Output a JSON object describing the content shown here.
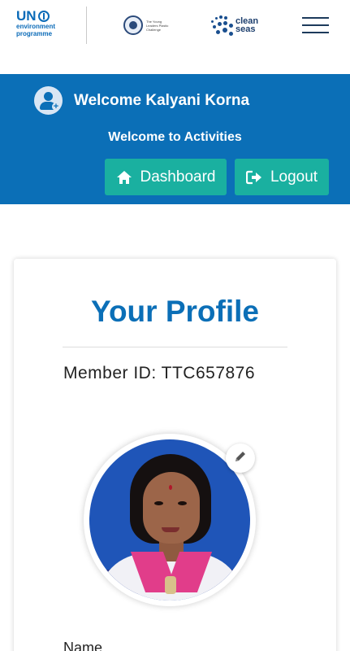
{
  "header": {
    "un_logo": {
      "line1": "UN",
      "line2": "environment",
      "line3": "programme"
    },
    "ylpc_logo": {
      "text": "The Young Leaders Plastic Challenge"
    },
    "cleanseas_logo": {
      "line1": "clean",
      "line2": "seas"
    },
    "menu_icon": "hamburger-icon"
  },
  "banner": {
    "welcome_user": "Welcome Kalyani Korna",
    "welcome_activities": "Welcome to Activities",
    "dashboard_label": "Dashboard",
    "logout_label": "Logout",
    "background_color": "#0b6fb7",
    "button_color": "#1ab0a0"
  },
  "profile": {
    "title": "Your Profile",
    "member_id": "Member ID: TTC657876",
    "name_label": "Name",
    "edit_icon": "pencil-icon",
    "title_color": "#0b6fb7"
  }
}
